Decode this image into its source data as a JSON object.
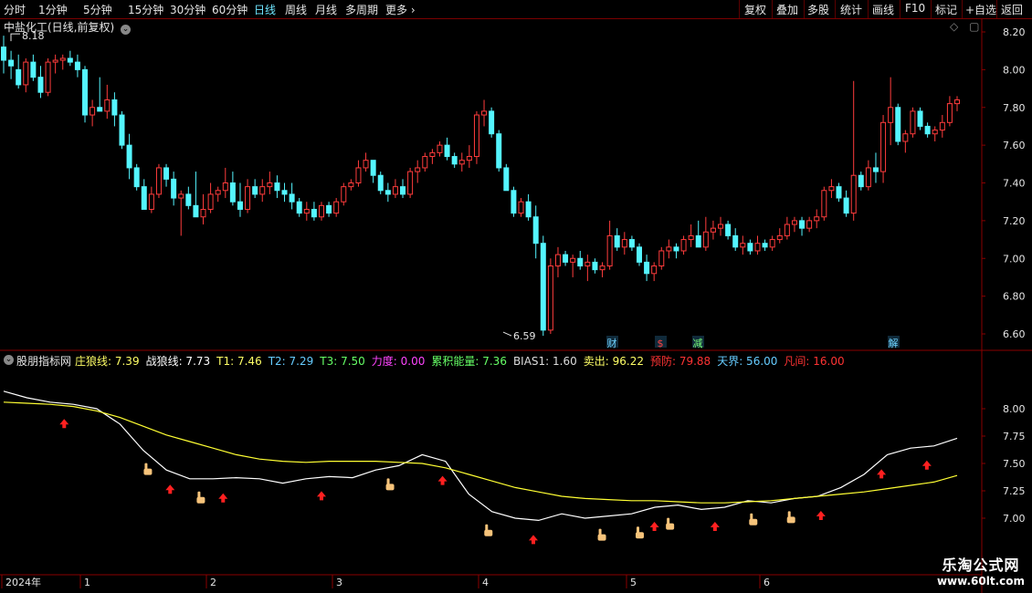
{
  "toolbar": {
    "periods": [
      "分时",
      "1分钟",
      "5分钟",
      "15分钟",
      "30分钟",
      "60分钟",
      "日线",
      "周线",
      "月线",
      "多周期",
      "更多"
    ],
    "active_period": "日线",
    "right_buttons": [
      "复权",
      "叠加",
      "多股",
      "统计",
      "画线",
      "F10",
      "标记",
      "+自选",
      "返回"
    ]
  },
  "main_title": "中盐化工(日线,前复权)",
  "indicator": {
    "name": "股朋指标网",
    "items": [
      {
        "label": "庄狼线: 7.39",
        "color": "#ffff66"
      },
      {
        "label": "战狼线: 7.73",
        "color": "#ffffff"
      },
      {
        "label": "T1: 7.46",
        "color": "#ffff66"
      },
      {
        "label": "T2: 7.29",
        "color": "#66ccff"
      },
      {
        "label": "T3: 7.50",
        "color": "#66ff66"
      },
      {
        "label": "力度: 0.00",
        "color": "#ff44ff"
      },
      {
        "label": "累积能量: 7.36",
        "color": "#66ff66"
      },
      {
        "label": "BIAS1: 1.60",
        "color": "#dddddd"
      },
      {
        "label": "卖出: 96.22",
        "color": "#ffff66"
      },
      {
        "label": "预防: 79.88",
        "color": "#ff3333"
      },
      {
        "label": "天界: 56.00",
        "color": "#66ccff"
      },
      {
        "label": "凡间: 16.00",
        "color": "#ff3333"
      }
    ]
  },
  "chart_data": [
    {
      "type": "candlestick",
      "ylim": [
        6.55,
        8.25
      ],
      "yticks": [
        "8.20",
        "8.00",
        "7.80",
        "7.60",
        "7.40",
        "7.20",
        "7.00",
        "6.80",
        "6.60"
      ],
      "yvalues": [
        8.2,
        8.0,
        7.8,
        7.6,
        7.4,
        7.2,
        7.0,
        6.8,
        6.6
      ],
      "annotations": [
        {
          "text": "8.18",
          "value": 8.18
        },
        {
          "text": "6.59",
          "value": 6.59
        }
      ],
      "event_markers": [
        "财",
        "$",
        "减",
        "解"
      ],
      "candles": [
        [
          8.12,
          8.18,
          7.98,
          8.05
        ],
        [
          8.05,
          8.1,
          7.95,
          8.02
        ],
        [
          8.0,
          8.08,
          7.9,
          7.92
        ],
        [
          7.92,
          8.06,
          7.88,
          8.04
        ],
        [
          8.04,
          8.08,
          7.94,
          7.96
        ],
        [
          7.96,
          8.02,
          7.85,
          7.88
        ],
        [
          7.88,
          8.06,
          7.86,
          8.04
        ],
        [
          8.04,
          8.08,
          7.98,
          8.05
        ],
        [
          8.05,
          8.08,
          8.0,
          8.06
        ],
        [
          8.06,
          8.1,
          8.02,
          8.04
        ],
        [
          8.04,
          8.08,
          7.96,
          8.0
        ],
        [
          8.0,
          8.02,
          7.72,
          7.76
        ],
        [
          7.76,
          7.84,
          7.7,
          7.8
        ],
        [
          7.8,
          7.96,
          7.78,
          7.78
        ],
        [
          7.78,
          7.92,
          7.74,
          7.84
        ],
        [
          7.84,
          7.88,
          7.7,
          7.76
        ],
        [
          7.76,
          7.78,
          7.58,
          7.6
        ],
        [
          7.6,
          7.66,
          7.42,
          7.48
        ],
        [
          7.48,
          7.5,
          7.36,
          7.38
        ],
        [
          7.38,
          7.42,
          7.28,
          7.26
        ],
        [
          7.26,
          7.38,
          7.24,
          7.34
        ],
        [
          7.34,
          7.5,
          7.32,
          7.48
        ],
        [
          7.48,
          7.5,
          7.38,
          7.42
        ],
        [
          7.42,
          7.46,
          7.28,
          7.32
        ],
        [
          7.32,
          7.36,
          7.12,
          7.34
        ],
        [
          7.34,
          7.38,
          7.26,
          7.28
        ],
        [
          7.28,
          7.46,
          7.24,
          7.22
        ],
        [
          7.22,
          7.34,
          7.18,
          7.26
        ],
        [
          7.26,
          7.4,
          7.24,
          7.34
        ],
        [
          7.34,
          7.38,
          7.3,
          7.36
        ],
        [
          7.36,
          7.48,
          7.32,
          7.4
        ],
        [
          7.4,
          7.46,
          7.28,
          7.3
        ],
        [
          7.3,
          7.4,
          7.22,
          7.26
        ],
        [
          7.26,
          7.42,
          7.24,
          7.38
        ],
        [
          7.38,
          7.42,
          7.32,
          7.34
        ],
        [
          7.34,
          7.42,
          7.3,
          7.38
        ],
        [
          7.38,
          7.46,
          7.34,
          7.4
        ],
        [
          7.4,
          7.44,
          7.32,
          7.36
        ],
        [
          7.36,
          7.4,
          7.3,
          7.34
        ],
        [
          7.34,
          7.4,
          7.26,
          7.3
        ],
        [
          7.3,
          7.32,
          7.22,
          7.24
        ],
        [
          7.24,
          7.3,
          7.2,
          7.26
        ],
        [
          7.26,
          7.3,
          7.2,
          7.22
        ],
        [
          7.22,
          7.3,
          7.2,
          7.28
        ],
        [
          7.28,
          7.3,
          7.22,
          7.24
        ],
        [
          7.24,
          7.32,
          7.22,
          7.3
        ],
        [
          7.3,
          7.4,
          7.28,
          7.38
        ],
        [
          7.38,
          7.42,
          7.36,
          7.4
        ],
        [
          7.4,
          7.52,
          7.38,
          7.48
        ],
        [
          7.48,
          7.56,
          7.46,
          7.52
        ],
        [
          7.52,
          7.5,
          7.4,
          7.44
        ],
        [
          7.44,
          7.46,
          7.34,
          7.36
        ],
        [
          7.36,
          7.4,
          7.3,
          7.34
        ],
        [
          7.34,
          7.42,
          7.32,
          7.38
        ],
        [
          7.38,
          7.42,
          7.32,
          7.34
        ],
        [
          7.34,
          7.48,
          7.32,
          7.46
        ],
        [
          7.46,
          7.52,
          7.4,
          7.48
        ],
        [
          7.48,
          7.56,
          7.46,
          7.54
        ],
        [
          7.54,
          7.58,
          7.5,
          7.56
        ],
        [
          7.56,
          7.62,
          7.54,
          7.6
        ],
        [
          7.6,
          7.64,
          7.52,
          7.54
        ],
        [
          7.54,
          7.56,
          7.48,
          7.5
        ],
        [
          7.5,
          7.56,
          7.46,
          7.52
        ],
        [
          7.52,
          7.6,
          7.48,
          7.54
        ],
        [
          7.54,
          7.78,
          7.5,
          7.76
        ],
        [
          7.76,
          7.84,
          7.7,
          7.78
        ],
        [
          7.78,
          7.8,
          7.64,
          7.66
        ],
        [
          7.66,
          7.68,
          7.46,
          7.48
        ],
        [
          7.48,
          7.5,
          7.36,
          7.36
        ],
        [
          7.36,
          7.38,
          7.22,
          7.24
        ],
        [
          7.24,
          7.32,
          7.22,
          7.3
        ],
        [
          7.3,
          7.34,
          7.2,
          7.22
        ],
        [
          7.22,
          7.28,
          7.0,
          7.08
        ],
        [
          7.08,
          7.12,
          6.59,
          6.62
        ],
        [
          6.62,
          7.0,
          6.6,
          6.96
        ],
        [
          6.96,
          7.06,
          6.9,
          7.02
        ],
        [
          7.02,
          7.04,
          6.96,
          6.98
        ],
        [
          6.98,
          7.02,
          6.9,
          7.0
        ],
        [
          7.0,
          7.04,
          6.94,
          6.96
        ],
        [
          6.96,
          7.02,
          6.88,
          6.98
        ],
        [
          6.98,
          7.0,
          6.92,
          6.94
        ],
        [
          6.94,
          6.98,
          6.9,
          6.96
        ],
        [
          6.96,
          7.2,
          6.94,
          7.12
        ],
        [
          7.12,
          7.16,
          7.04,
          7.06
        ],
        [
          7.06,
          7.14,
          7.02,
          7.1
        ],
        [
          7.1,
          7.12,
          7.04,
          7.06
        ],
        [
          7.06,
          7.08,
          6.96,
          6.98
        ],
        [
          6.98,
          7.02,
          6.88,
          6.92
        ],
        [
          6.92,
          6.98,
          6.88,
          6.96
        ],
        [
          6.96,
          7.06,
          6.94,
          7.04
        ],
        [
          7.04,
          7.1,
          7.0,
          7.06
        ],
        [
          7.06,
          7.08,
          7.0,
          7.04
        ],
        [
          7.04,
          7.12,
          7.02,
          7.1
        ],
        [
          7.1,
          7.18,
          7.06,
          7.12
        ],
        [
          7.12,
          7.2,
          7.08,
          7.06
        ],
        [
          7.06,
          7.22,
          7.04,
          7.14
        ],
        [
          7.14,
          7.2,
          7.1,
          7.16
        ],
        [
          7.16,
          7.22,
          7.12,
          7.18
        ],
        [
          7.18,
          7.2,
          7.1,
          7.12
        ],
        [
          7.12,
          7.16,
          7.04,
          7.06
        ],
        [
          7.06,
          7.12,
          7.02,
          7.08
        ],
        [
          7.08,
          7.1,
          7.02,
          7.04
        ],
        [
          7.04,
          7.12,
          7.02,
          7.08
        ],
        [
          7.08,
          7.1,
          7.04,
          7.06
        ],
        [
          7.06,
          7.12,
          7.04,
          7.1
        ],
        [
          7.1,
          7.16,
          7.08,
          7.12
        ],
        [
          7.12,
          7.22,
          7.1,
          7.18
        ],
        [
          7.18,
          7.22,
          7.14,
          7.2
        ],
        [
          7.2,
          7.22,
          7.12,
          7.16
        ],
        [
          7.16,
          7.22,
          7.14,
          7.2
        ],
        [
          7.2,
          7.26,
          7.16,
          7.22
        ],
        [
          7.22,
          7.38,
          7.2,
          7.36
        ],
        [
          7.36,
          7.42,
          7.32,
          7.38
        ],
        [
          7.38,
          7.4,
          7.3,
          7.32
        ],
        [
          7.32,
          7.36,
          7.22,
          7.24
        ],
        [
          7.24,
          7.94,
          7.2,
          7.44
        ],
        [
          7.44,
          7.46,
          7.36,
          7.38
        ],
        [
          7.38,
          7.52,
          7.36,
          7.48
        ],
        [
          7.48,
          7.56,
          7.4,
          7.46
        ],
        [
          7.46,
          7.76,
          7.4,
          7.72
        ],
        [
          7.72,
          7.96,
          7.6,
          7.8
        ],
        [
          7.8,
          7.82,
          7.6,
          7.62
        ],
        [
          7.62,
          7.68,
          7.56,
          7.66
        ],
        [
          7.66,
          7.8,
          7.64,
          7.78
        ],
        [
          7.78,
          7.8,
          7.68,
          7.7
        ],
        [
          7.7,
          7.72,
          7.64,
          7.66
        ],
        [
          7.66,
          7.7,
          7.62,
          7.68
        ],
        [
          7.68,
          7.76,
          7.64,
          7.72
        ],
        [
          7.72,
          7.86,
          7.7,
          7.82
        ],
        [
          7.82,
          7.86,
          7.78,
          7.84
        ]
      ]
    },
    {
      "type": "line",
      "ylim": [
        6.55,
        8.25
      ],
      "yticks": [
        "8.00",
        "7.75",
        "7.50",
        "7.25",
        "7.00"
      ],
      "yvalues": [
        8.0,
        7.75,
        7.5,
        7.25,
        7.0
      ],
      "xticks": [
        "2024年",
        "1",
        "2",
        "3",
        "4",
        "5",
        "6"
      ],
      "series": [
        {
          "name": "战狼线",
          "color": "#ffffff",
          "values": [
            8.16,
            8.1,
            8.06,
            8.04,
            8.0,
            7.86,
            7.62,
            7.44,
            7.36,
            7.36,
            7.37,
            7.36,
            7.32,
            7.36,
            7.38,
            7.37,
            7.44,
            7.48,
            7.58,
            7.52,
            7.22,
            7.06,
            7.0,
            6.98,
            7.04,
            7.0,
            7.02,
            7.04,
            7.1,
            7.12,
            7.08,
            7.1,
            7.16,
            7.14,
            7.18,
            7.2,
            7.28,
            7.4,
            7.58,
            7.64,
            7.66,
            7.73
          ]
        },
        {
          "name": "庄狼线",
          "color": "#ffff33",
          "values": [
            8.06,
            8.05,
            8.04,
            8.02,
            7.98,
            7.92,
            7.84,
            7.76,
            7.7,
            7.64,
            7.58,
            7.54,
            7.52,
            7.51,
            7.52,
            7.52,
            7.52,
            7.51,
            7.5,
            7.46,
            7.4,
            7.34,
            7.28,
            7.24,
            7.2,
            7.18,
            7.17,
            7.16,
            7.16,
            7.15,
            7.14,
            7.14,
            7.15,
            7.16,
            7.18,
            7.2,
            7.22,
            7.24,
            7.27,
            7.3,
            7.33,
            7.39
          ]
        }
      ],
      "buy_arrows": [
        0.8,
        2.2,
        2.9,
        4.2,
        5.8,
        7.0,
        8.6,
        9.4,
        10.8,
        11.6,
        12.2
      ],
      "hand_markers": [
        1.9,
        2.6,
        5.1,
        6.4,
        7.9,
        8.4,
        8.8,
        9.9,
        10.4
      ]
    }
  ]
}
